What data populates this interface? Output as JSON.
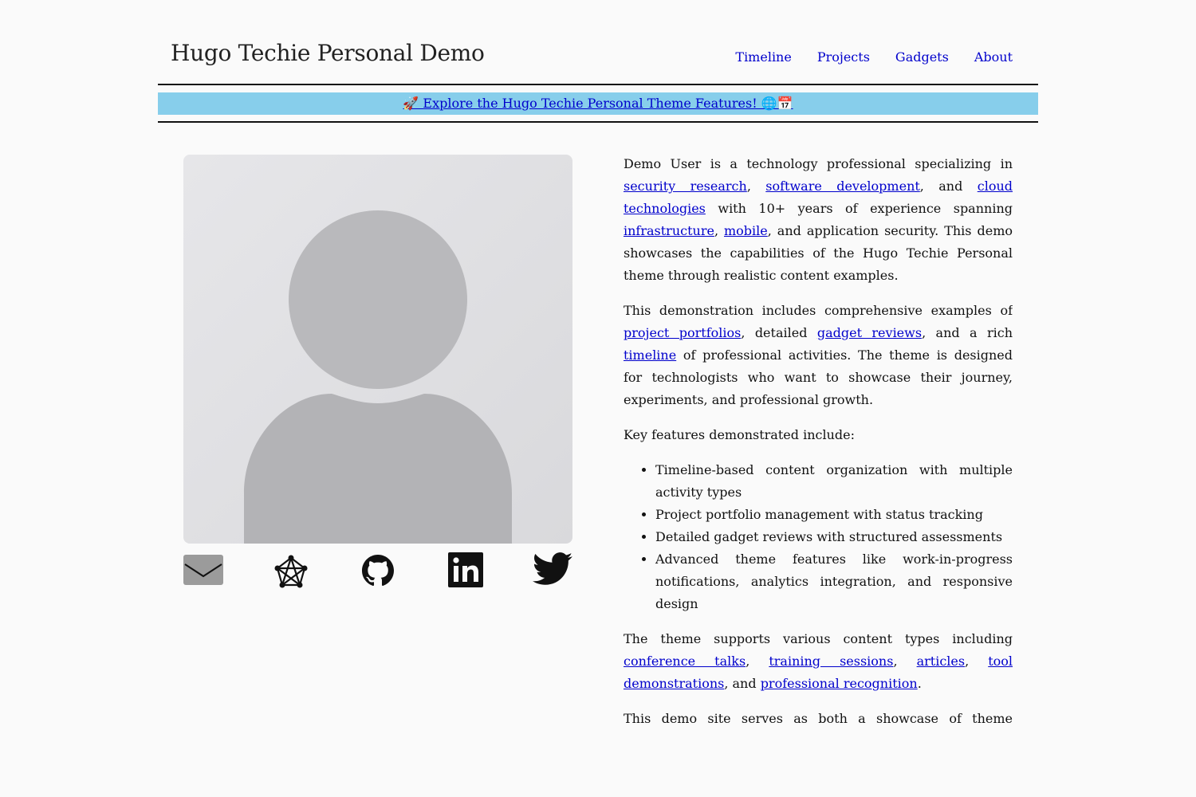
{
  "site": {
    "title": "Hugo Techie Personal Demo"
  },
  "nav": [
    {
      "label": "Timeline"
    },
    {
      "label": "Projects"
    },
    {
      "label": "Gadgets"
    },
    {
      "label": "About"
    }
  ],
  "banner": {
    "label": "🚀 Explore the Hugo Techie Personal Theme Features! 🌐📅"
  },
  "avatar": {
    "icon": "person-silhouette-icon"
  },
  "socials": [
    {
      "icon": "email-icon"
    },
    {
      "icon": "fediverse-icon"
    },
    {
      "icon": "github-icon"
    },
    {
      "icon": "linkedin-icon"
    },
    {
      "icon": "twitter-icon"
    }
  ],
  "bio": {
    "p1": {
      "t1": "Demo User is a technology professional specializing in ",
      "l1": "security research",
      "t2": ", ",
      "l2": "software development",
      "t3": ", and ",
      "l3": "cloud technologies",
      "t4": " with 10+ years of experience spanning ",
      "l4": "infrastructure",
      "t5": ", ",
      "l5": "mobile",
      "t6": ", and application security. This demo showcases the capabilities of the Hugo Techie Personal theme through realistic content examples."
    },
    "p2": {
      "t1": "This demonstration includes comprehensive examples of ",
      "l1": "project portfolios",
      "t2": ", detailed ",
      "l2": "gadget reviews",
      "t3": ", and a rich ",
      "l3": "timeline",
      "t4": " of professional activities. The theme is designed for technologists who want to showcase their journey, experiments, and professional growth."
    },
    "p3": "Key features demonstrated include:",
    "features": [
      {
        "bold": "Timeline-based content organization",
        "rest": " with multiple activity types"
      },
      {
        "bold": "Project portfolio management",
        "rest": " with status tracking"
      },
      {
        "bold": "Detailed gadget reviews",
        "rest": " with structured assessments"
      },
      {
        "bold": "Advanced theme features",
        "rest": " like work-in-progress notifications, analytics integration, and responsive design"
      }
    ],
    "p4": {
      "t1": "The theme supports various content types including ",
      "l1": "conference talks",
      "t2": ", ",
      "l2": "training sessions",
      "t3": ", ",
      "l3": "articles",
      "t4": ", ",
      "l4": "tool demonstrations",
      "t5": ", and ",
      "l5": "professional recognition",
      "t6": "."
    },
    "p5": "This demo site serves as both a showcase of theme capabilities and a template for tech professionals looking to create their"
  }
}
